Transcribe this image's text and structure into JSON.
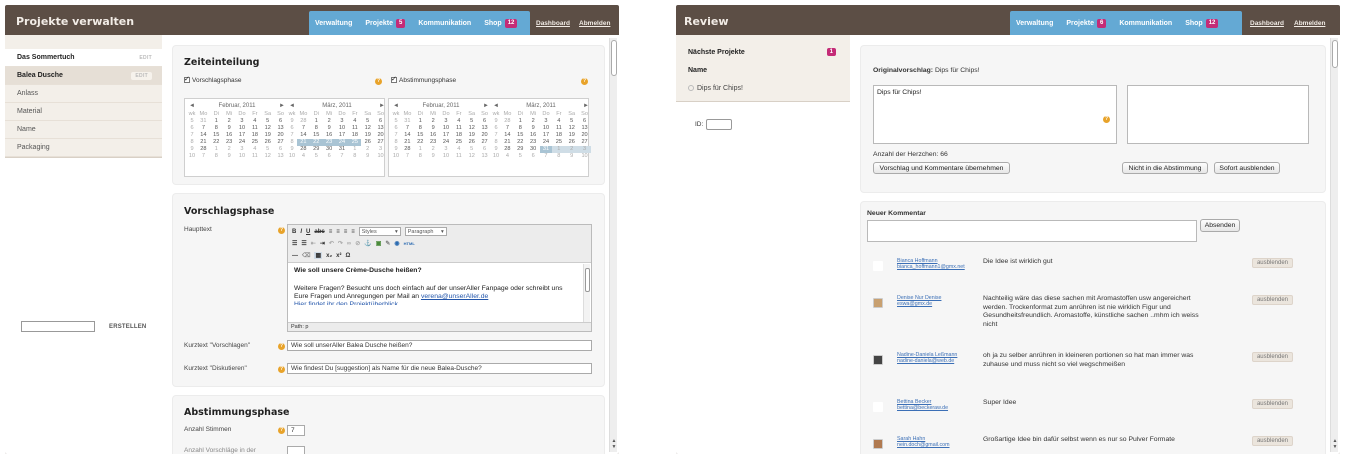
{
  "left": {
    "title": "Projekte verwalten",
    "tabs": [
      {
        "label": "Verwaltung",
        "badge": ""
      },
      {
        "label": "Projekte",
        "badge": "5"
      },
      {
        "label": "Kommunikation",
        "badge": ""
      },
      {
        "label": "Shop",
        "badge": "12"
      }
    ],
    "links": {
      "dashboard": "Dashboard",
      "logout": "Abmelden"
    },
    "sidebar": {
      "projects": [
        {
          "label": "Das Sommertuch",
          "edit": "EDIT"
        },
        {
          "label": "Balea Dusche",
          "edit": "EDIT"
        }
      ],
      "sections": [
        "Anlass",
        "Material",
        "Name",
        "Packaging"
      ],
      "create_input_value": "",
      "create_label": "ERSTELLEN"
    },
    "zeiteinteilung": {
      "heading": "Zeiteinteilung",
      "phase1": "Vorschlagsphase",
      "phase2": "Abstimmungsphase",
      "cal_months": [
        {
          "name": "Februar, 2011",
          "prev": "◄",
          "next": "►"
        },
        {
          "name": "März, 2011",
          "prev": "◄",
          "next": "►"
        },
        {
          "name": "Februar, 2011",
          "prev": "◄",
          "next": "►"
        },
        {
          "name": "März, 2011",
          "prev": "◄",
          "next": "►"
        }
      ],
      "weekdays": [
        "Mo",
        "Di",
        "Mi",
        "Do",
        "Fr",
        "Sa",
        "So"
      ]
    },
    "vorschlagsphase": {
      "heading": "Vorschlagsphase",
      "haupttext_label": "Haupttext",
      "styles_select": "Styles",
      "paragraph_select": "Paragraph",
      "question": "Wie soll unsere Crème-Dusche heißen?",
      "body_text": "Weitere Fragen? Besucht uns doch einfach auf der unserAller Fanpage oder schreibt uns Eure Fragen und Anregungen per Mail an",
      "email": "verena@unserAller.de",
      "more_link": "Hier findet ihr den Projektüberblick",
      "path": "Path: p",
      "kurz_vorschlagen_label": "Kurztext \"Vorschlagen\"",
      "kurz_vorschlagen_value": "Wie soll unserAller Balea Dusche heißen?",
      "kurz_diskutieren_label": "Kurztext \"Diskutieren\"",
      "kurz_diskutieren_value": "Wie findest Du [suggestion] als Name für die neue Balea-Dusche?"
    },
    "abstimmungsphase": {
      "heading": "Abstimmungsphase",
      "stimmen_label": "Anzahl Stimmen",
      "stimmen_value": "7",
      "second_label": "Anzahl Vorschläge in der"
    }
  },
  "right": {
    "title": "Review",
    "tabs": [
      {
        "label": "Verwaltung",
        "badge": ""
      },
      {
        "label": "Projekte",
        "badge": "6"
      },
      {
        "label": "Kommunikation",
        "badge": ""
      },
      {
        "label": "Shop",
        "badge": "12"
      }
    ],
    "links": {
      "dashboard": "Dashboard",
      "logout": "Abmelden"
    },
    "sidebar": {
      "next_projects": "Nächste Projekte",
      "next_count": "1",
      "name_label": "Name",
      "item": "Dips für Chips!",
      "id_label": "ID:"
    },
    "proposal": {
      "label": "Originalvorschlag:",
      "value": "Dips für Chips!",
      "textarea1": "Dips für Chips!",
      "textarea2": "",
      "hearts": "Anzahl der Herzchen: 66",
      "btn_apply": "Vorschlag und Kommentare übernehmen",
      "btn_not_vote": "Nicht in die Abstimmung",
      "btn_hide_now": "Sofort ausblenden"
    },
    "new_comment": {
      "heading": "Neuer Kommentar",
      "send": "Absenden"
    },
    "comments": [
      {
        "name": "Bianca Hoffmann",
        "email": "bianca_hoffmann1@gmx.net",
        "text": "Die Idee ist wirklich gut",
        "hide": "ausblenden",
        "avatar": "#ffffff"
      },
      {
        "name": "Denise Nur Denise",
        "email": "eswa@gmx.de",
        "text": "Nachteilig wäre das diese sachen mit Aromastoffen usw angereichert werden. Trockenformat zum anrühren ist nie wirklich Figur und Gesundheitsfreundlich. Aromastoffe, künstliche sachen ..mhm ich weiss nicht",
        "hide": "ausblenden",
        "avatar": "#c8a070"
      },
      {
        "name": "Nadine-Daniela Leßmann",
        "email": "nadine-daniela@web.de",
        "text": "oh ja zu selber anrühren in kleineren portionen so hat man immer was zuhause und muss nicht so viel wegschmeißen",
        "hide": "ausblenden",
        "avatar": "#444444"
      },
      {
        "name": "Bettina Becker",
        "email": "bettina@beckeraw.de",
        "text": "Super Idee",
        "hide": "ausblenden",
        "avatar": "#ffffff"
      },
      {
        "name": "Sarah Hahn",
        "email": "nein.doch@gmail.com",
        "text": "Großartige Idee bin dafür selbst wenn es nur so Pulver Formate",
        "hide": "ausblenden",
        "avatar": "#b07a50"
      }
    ]
  }
}
